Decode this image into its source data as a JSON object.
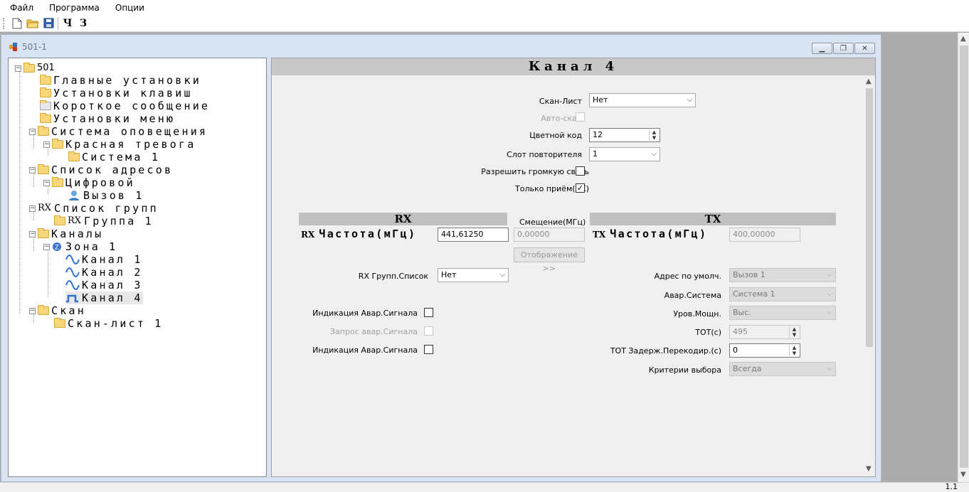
{
  "menubar": {
    "items": [
      "Файл",
      "Программа",
      "Опции"
    ]
  },
  "toolbar": {
    "btn_ch": "Ч",
    "btn_z": "З"
  },
  "statusbar": {
    "text": "1.1"
  },
  "child_window": {
    "title": "501-1"
  },
  "tree": {
    "root": "501",
    "nodes": [
      "Главные установки",
      "Установки клавиш",
      "Короткое сообщение",
      "Установки меню",
      "Система оповещения",
      "Красная тревога",
      "Система 1",
      "Список адресов",
      "Цифровой",
      "Вызов 1",
      "Список групп",
      "Группа 1",
      "Каналы",
      "Зона 1",
      "Канал 1",
      "Канал 2",
      "Канал 3",
      "Канал 4",
      "Скан",
      "Скан-лист 1"
    ],
    "rx_prefix": "RX"
  },
  "panel": {
    "title": "Канал 4",
    "scan_list_label": "Скан-Лист",
    "scan_list_value": "Нет",
    "auto_scan_label": "Авто-скан",
    "color_code_label": "Цветной код",
    "color_code_value": "12",
    "repeater_slot_label": "Слот повторителя",
    "repeater_slot_value": "1",
    "allow_talkaround_label": "Разрешить громкую связь",
    "rx_only_label": "Только приём(RX)",
    "rx_only_checked": "✓",
    "rx_header": "RX",
    "tx_header": "TX",
    "offset_label": "Смещение(МГц)",
    "freq_prefix_rx": "RX",
    "freq_prefix_tx": "TX",
    "rx_freq_label": "Частота(мГц)",
    "tx_freq_label": "Частота(мГц)",
    "rx_freq_value": "441,61250",
    "offset_value": "0,00000",
    "tx_freq_value": "400,00000",
    "mapping_button": "Отображение >>",
    "rx_group_list_label": "RX Групп.Список",
    "rx_group_list_value": "Нет",
    "alarm_indication_1_label": "Индикация Авар.Сигнала",
    "alarm_request_label": "Запрос авар.Сигнала",
    "alarm_indication_2_label": "Индикация Авар.Сигнала",
    "default_address_label": "Адрес по умолч.",
    "default_address_value": "Вызов 1",
    "alarm_system_label": "Авар.Система",
    "alarm_system_value": "Система 1",
    "power_level_label": "Уров.Мощн.",
    "power_level_value": "Выс.",
    "tot_label": "ТОТ(с)",
    "tot_value": "495",
    "tot_rekey_label": "ТОТ Задерж.Перекодир.(с)",
    "tot_rekey_value": "0",
    "admit_criteria_label": "Критерии выбора",
    "admit_criteria_value": "Всегда"
  }
}
